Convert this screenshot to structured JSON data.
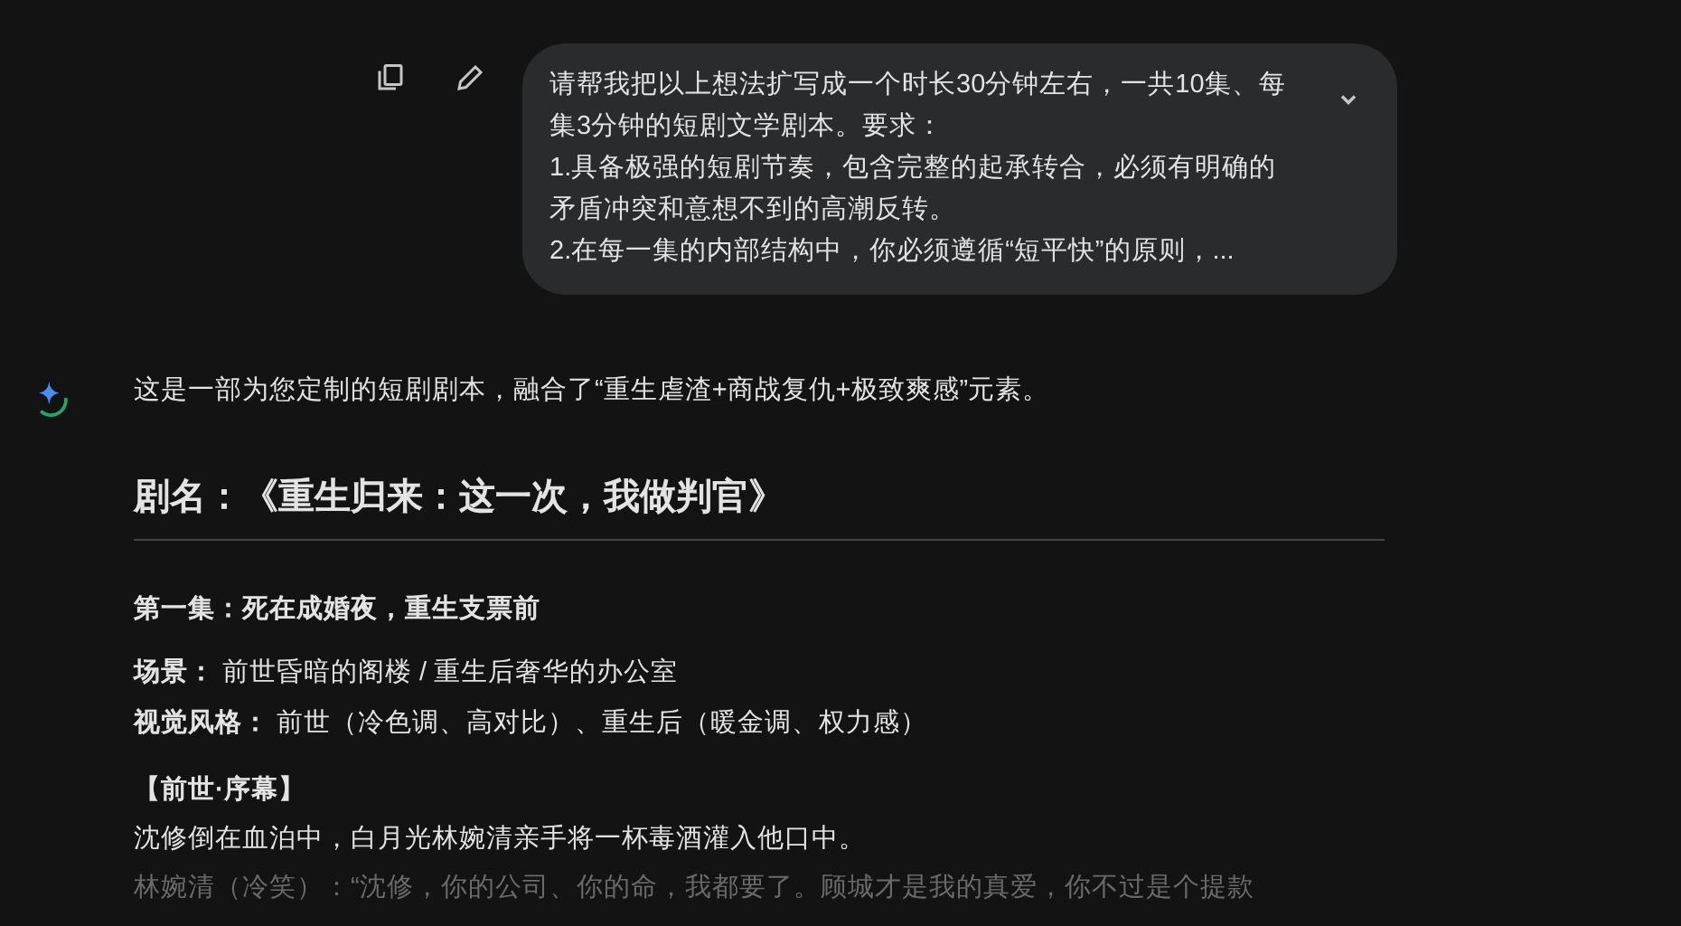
{
  "user_message": {
    "paragraphs": [
      "请帮我把以上想法扩写成一个时长30分钟左右，一共10集、每集3分钟的短剧文学剧本。要求：",
      "1.具备极强的短剧节奏，包含完整的起承转合，必须有明确的矛盾冲突和意想不到的高潮反转。",
      "2.在每一集的内部结构中，你必须遵循“短平快”的原则，..."
    ],
    "expanded": false
  },
  "response": {
    "intro": "这是一部为您定制的短剧剧本，融合了“重生虐渣+商战复仇+极致爽感”元素。",
    "title": "剧名：《重生归来：这一次，我做判官》",
    "episode_heading": "第一集：死在成婚夜，重生支票前",
    "meta": [
      "**场景：** 前世昏暗的阁楼 / 重生后奢华的办公室",
      "**视觉风格：** 前世（冷色调、高对比）、重生后（暖金调、权力感）"
    ],
    "section_heading": "【前世·序幕】",
    "lines": [
      {
        "text": "沈修倒在血泊中，白月光林婉清亲手将一杯毒酒灌入他口中。",
        "faded": false
      },
      {
        "text": "林婉清（冷笑）：“沈修，你的公司、你的命，我都要了。顾城才是我的真爱，你不过是个提款",
        "faded": true
      }
    ]
  }
}
